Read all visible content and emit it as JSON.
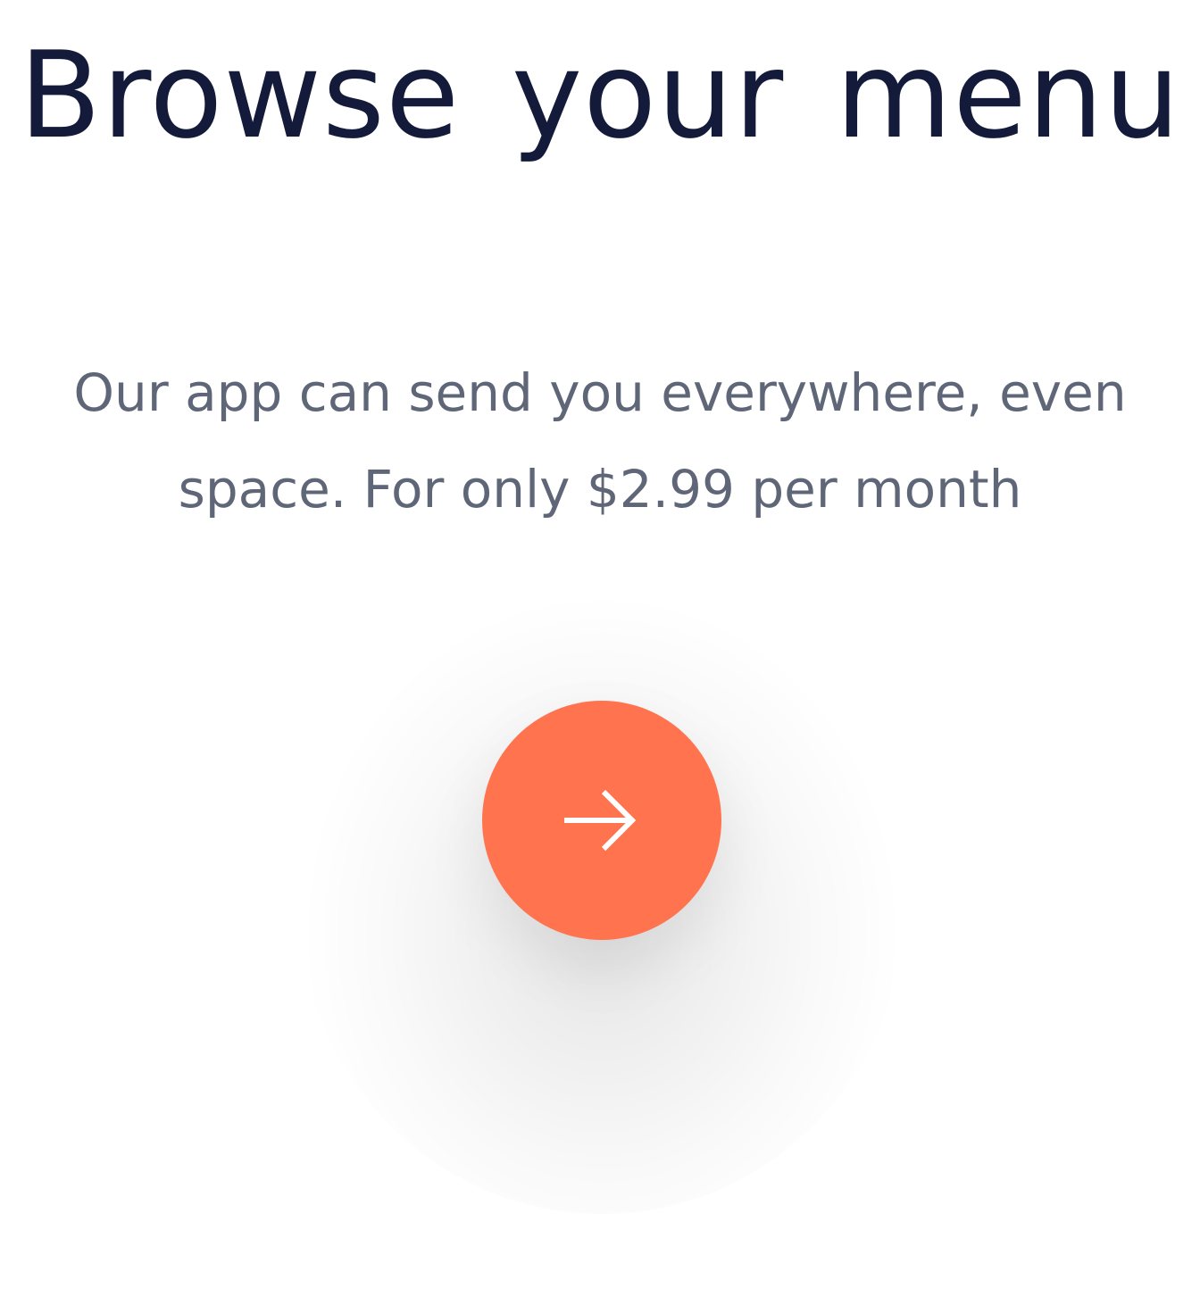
{
  "screen": {
    "title": "Browse your  menu",
    "subtitle": "Our app can send you everywhere, even space. For only $2.99 per month"
  },
  "next_button": {
    "icon": "arrow-right-icon"
  },
  "colors": {
    "background": "#ffffff",
    "title": "#141b3a",
    "subtitle": "#5f6677",
    "accent": "#ff744f",
    "icon": "#ffffff"
  }
}
